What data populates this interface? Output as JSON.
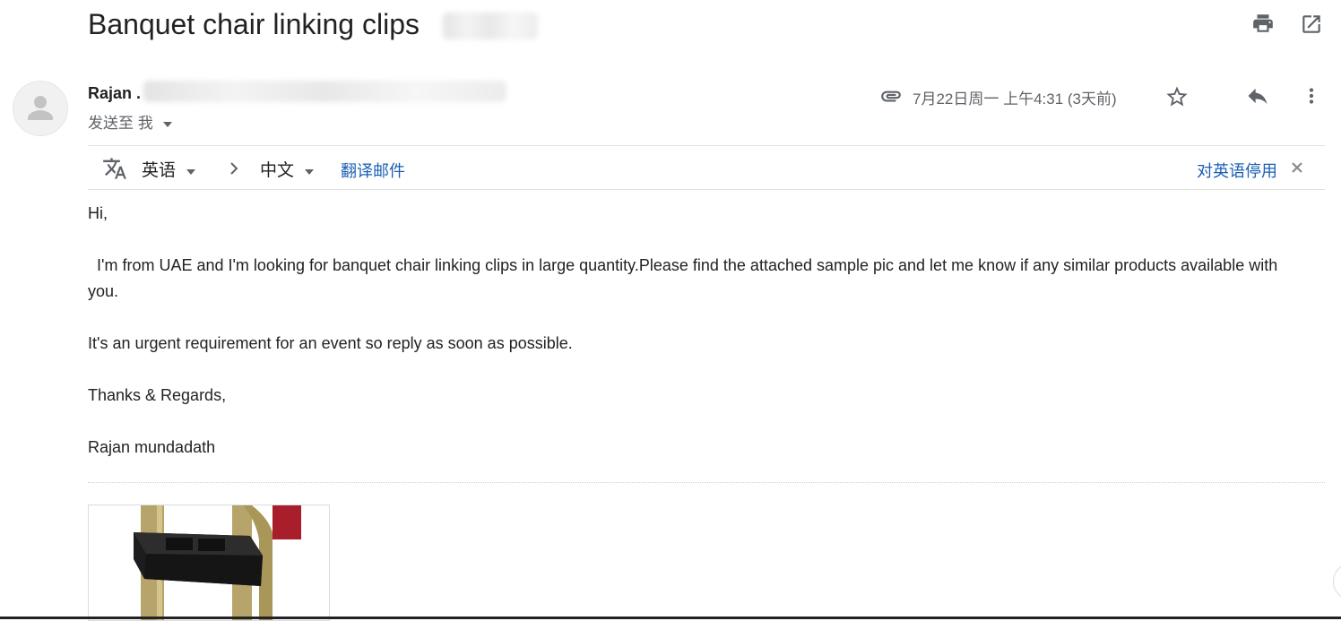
{
  "email": {
    "subject": "Banquet chair linking clips",
    "sender_name": "Rajan .",
    "to_label": "发送至 我",
    "date": "7月22日周一 上午4:31 (3天前)"
  },
  "translate_bar": {
    "source_lang": "英语",
    "target_lang": "中文",
    "translate_link": "翻译邮件",
    "disable_link": "对英语停用"
  },
  "body": {
    "greeting": "Hi,",
    "paragraph1": "  I'm from UAE and I'm looking for banquet chair linking clips in large quantity.Please find the attached sample pic and let me know if any similar products available with you.",
    "paragraph2": "It's an urgent requirement for an event so reply as soon as possible.",
    "closing": "Thanks & Regards,",
    "signature": "Rajan mundadath"
  },
  "icons": {
    "print": "print-icon",
    "open_new_window": "open-in-new-icon",
    "attachment": "paperclip-icon",
    "star": "star-icon",
    "reply": "reply-icon",
    "more": "more-vert-icon",
    "translate": "translate-icon"
  }
}
